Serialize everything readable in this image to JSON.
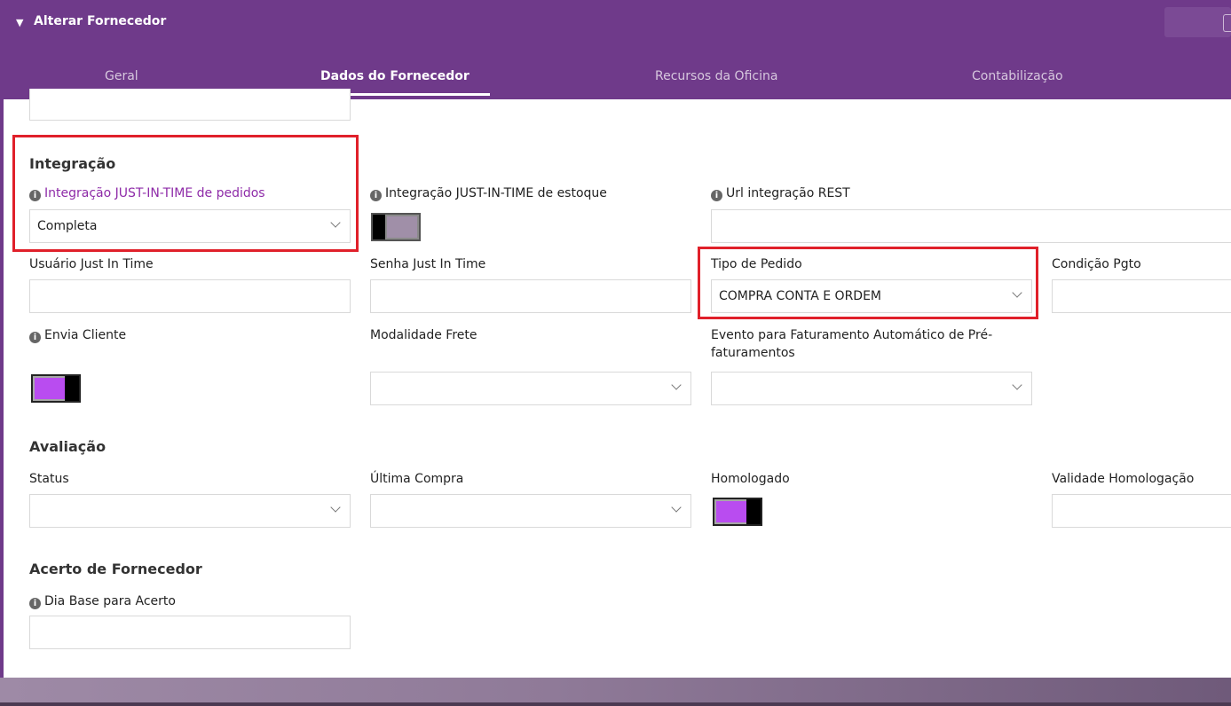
{
  "header": {
    "title": "Alterar Fornecedor",
    "tabs": [
      {
        "label": "Geral",
        "active": false
      },
      {
        "label": "Dados do Fornecedor",
        "active": true
      },
      {
        "label": "Recursos da Oficina",
        "active": false
      },
      {
        "label": "Contabilização",
        "active": false
      }
    ]
  },
  "integracao": {
    "section_title": "Integração",
    "jit_pedidos_label": "Integração JUST-IN-TIME de pedidos",
    "jit_pedidos_value": "Completa",
    "jit_estoque_label": "Integração JUST-IN-TIME de estoque",
    "jit_estoque_on": false,
    "url_rest_label": "Url integração REST",
    "url_rest_value": "",
    "usuario_label": "Usuário Just In Time",
    "usuario_value": "",
    "senha_label": "Senha Just In Time",
    "senha_value": "",
    "tipo_pedido_label": "Tipo de Pedido",
    "tipo_pedido_value": "COMPRA CONTA E ORDEM",
    "condicao_label": "Condição Pgto",
    "condicao_value": "",
    "envia_cliente_label": "Envia Cliente",
    "envia_cliente_on": true,
    "modalidade_label": "Modalidade Frete",
    "modalidade_value": "",
    "evento_label_line1": "Evento para Faturamento Automático de Pré-",
    "evento_label_line2": "faturamentos",
    "evento_value": ""
  },
  "avaliacao": {
    "section_title": "Avaliação",
    "status_label": "Status",
    "status_value": "",
    "ultima_compra_label": "Última Compra",
    "ultima_compra_value": "",
    "homologado_label": "Homologado",
    "homologado_on": true,
    "validade_label": "Validade Homologação",
    "validade_value": ""
  },
  "acerto": {
    "section_title": "Acerto de Fornecedor",
    "dia_base_label": "Dia Base para Acerto",
    "dia_base_value": ""
  },
  "colors": {
    "brand_purple": "#6f3a8a",
    "toggle_on": "#b94cf0",
    "highlight_red": "#e0202a",
    "link_purple": "#8e2ba8"
  }
}
